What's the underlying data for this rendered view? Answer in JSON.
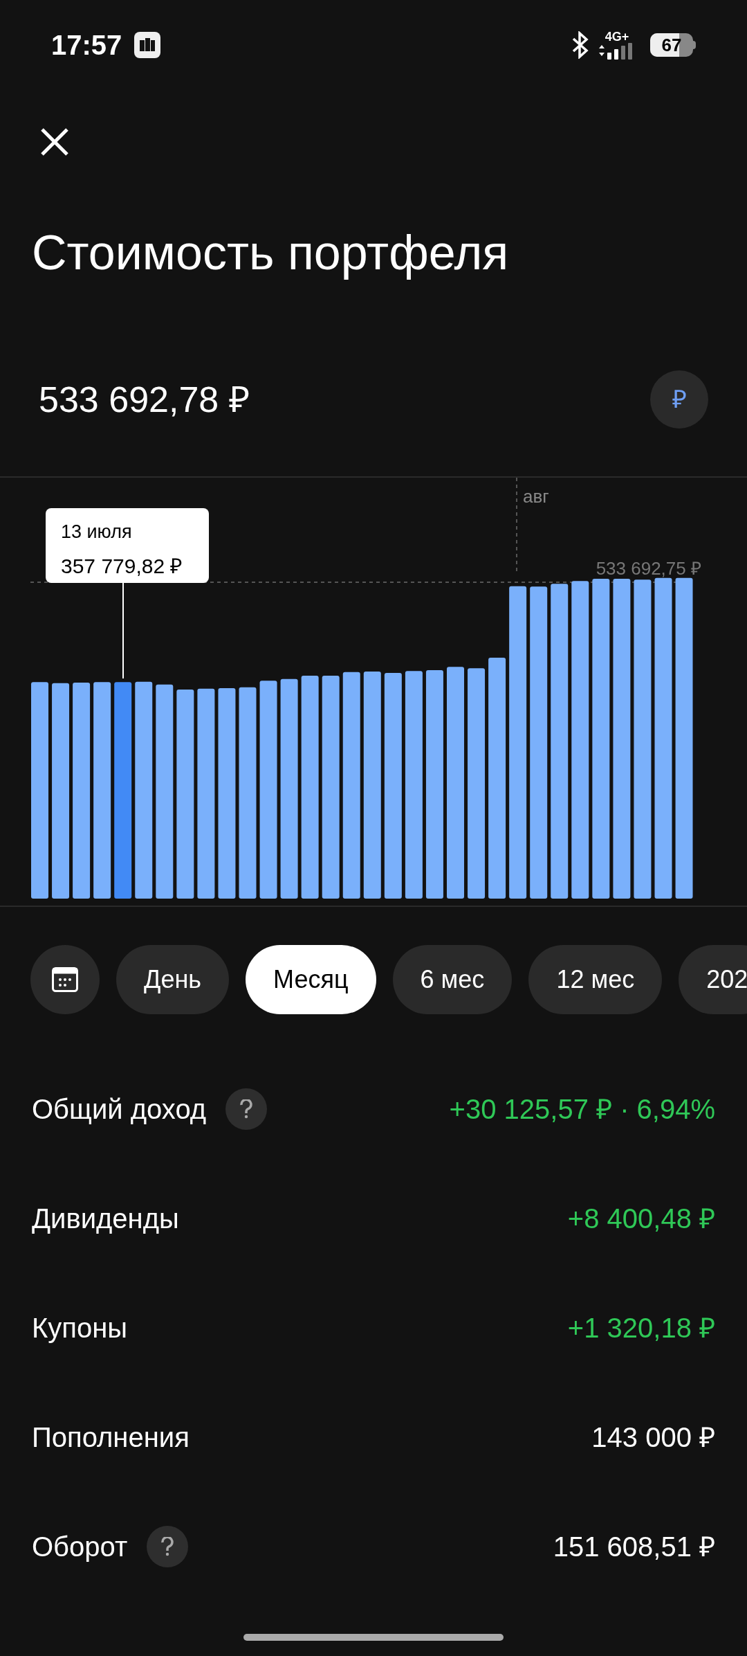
{
  "status_bar": {
    "time": "17:57",
    "network": "4G+",
    "battery": "67"
  },
  "title": "Стоимость портфеля",
  "total": "533 692,78 ₽",
  "currency_button": "₽",
  "chart": {
    "month_label": "авг",
    "max_label": "533 692,75 ₽",
    "tooltip": {
      "date": "13 июля",
      "value": "357 779,82 ₽"
    }
  },
  "periods": [
    {
      "label": "День",
      "selected": false
    },
    {
      "label": "Месяц",
      "selected": true
    },
    {
      "label": "6 мес",
      "selected": false
    },
    {
      "label": "12 мес",
      "selected": false
    },
    {
      "label": "202",
      "selected": false
    }
  ],
  "stats": [
    {
      "label": "Общий доход",
      "help": true,
      "value": "+30 125,57 ₽ · 6,94%",
      "positive": true
    },
    {
      "label": "Дивиденды",
      "help": false,
      "value": "+8 400,48 ₽",
      "positive": true
    },
    {
      "label": "Купоны",
      "help": false,
      "value": "+1 320,18 ₽",
      "positive": true
    },
    {
      "label": "Пополнения",
      "help": false,
      "value": "143 000 ₽",
      "positive": false
    },
    {
      "label": "Оборот",
      "help": true,
      "value": "151 608,51 ₽",
      "positive": false
    }
  ]
}
